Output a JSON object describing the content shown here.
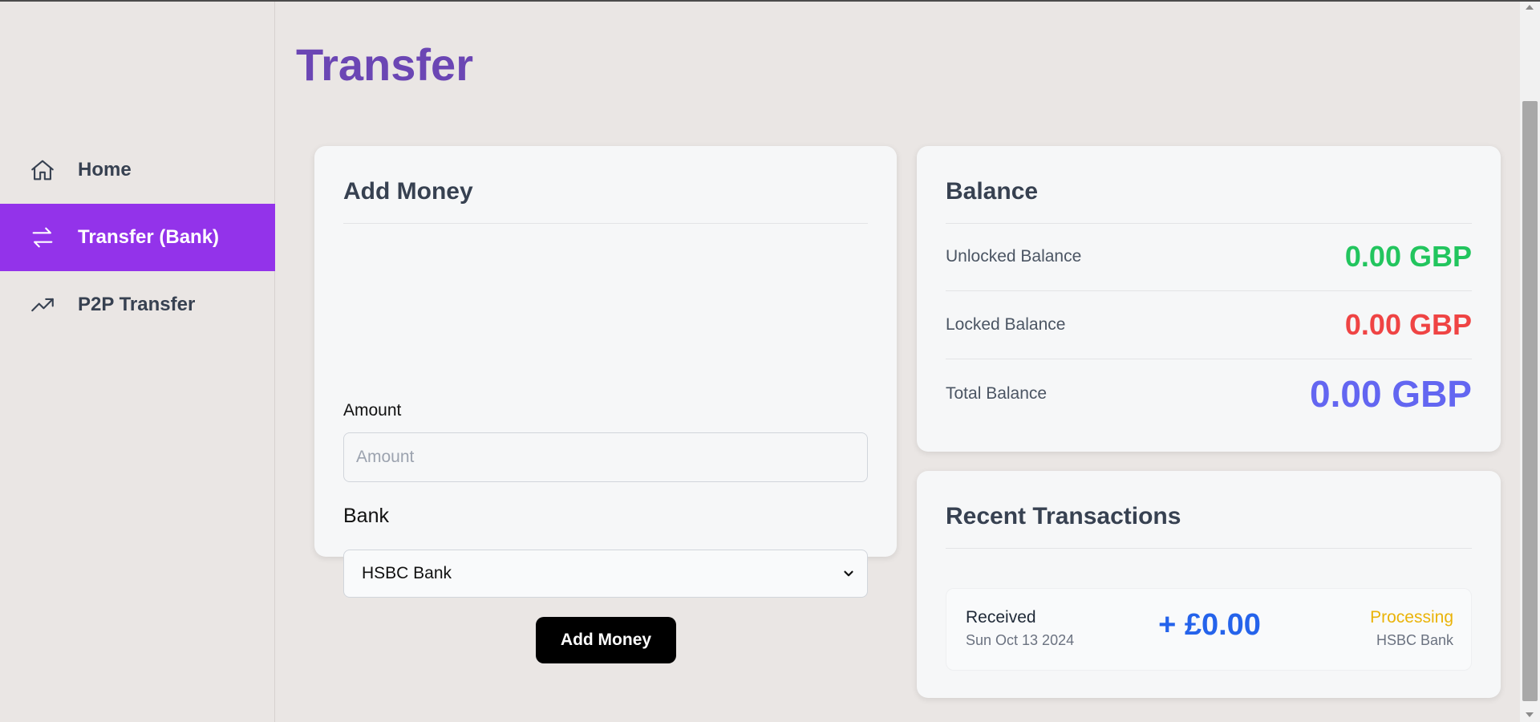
{
  "page": {
    "title": "Transfer"
  },
  "sidebar": {
    "items": [
      {
        "label": "Home",
        "icon": "home-icon",
        "active": false
      },
      {
        "label": "Transfer (Bank)",
        "icon": "transfer-arrows-icon",
        "active": true
      },
      {
        "label": "P2P Transfer",
        "icon": "trending-up-icon",
        "active": false
      }
    ]
  },
  "add_money": {
    "title": "Add Money",
    "amount_label": "Amount",
    "amount_placeholder": "Amount",
    "amount_value": "",
    "bank_label": "Bank",
    "bank_selected": "HSBC Bank",
    "button_label": "Add Money"
  },
  "balance": {
    "title": "Balance",
    "rows": [
      {
        "label": "Unlocked Balance",
        "value": "0.00 GBP",
        "color": "#22c55e"
      },
      {
        "label": "Locked Balance",
        "value": "0.00 GBP",
        "color": "#ef4444"
      },
      {
        "label": "Total Balance",
        "value": "0.00 GBP",
        "color": "#6366f1"
      }
    ]
  },
  "transactions": {
    "title": "Recent Transactions",
    "items": [
      {
        "type": "Received",
        "date": "Sun Oct 13 2024",
        "amount": "+ £0.00",
        "status": "Processing",
        "bank": "HSBC Bank"
      }
    ]
  },
  "colors": {
    "accent": "#9333ea",
    "title": "#6b46b4",
    "background": "#eae6e4"
  }
}
